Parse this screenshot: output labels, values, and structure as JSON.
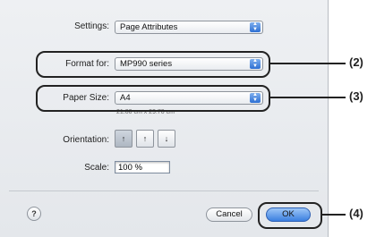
{
  "settings": {
    "label": "Settings:",
    "value": "Page Attributes"
  },
  "format_for": {
    "label": "Format for:",
    "value": "MP990 series"
  },
  "paper_size": {
    "label": "Paper Size:",
    "value": "A4",
    "dimensions": "21.00 cm x 29.70 cm"
  },
  "orientation": {
    "label": "Orientation:",
    "options": [
      "portrait",
      "landscape-left",
      "landscape-right"
    ],
    "selected": "portrait"
  },
  "scale": {
    "label": "Scale:",
    "value": "100 %"
  },
  "footer": {
    "help": "?",
    "cancel": "Cancel",
    "ok": "OK"
  },
  "callouts": [
    "(2)",
    "(3)",
    "(4)"
  ]
}
